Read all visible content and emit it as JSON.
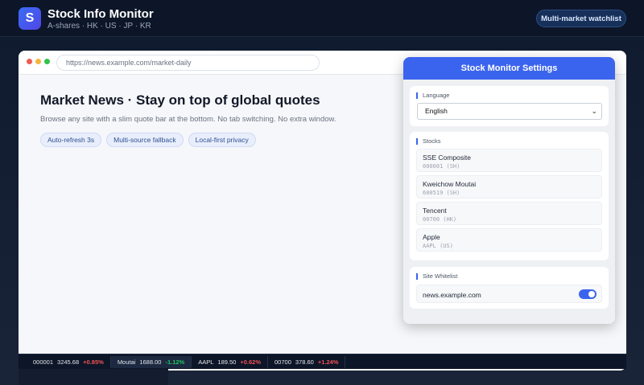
{
  "app": {
    "logo_letter": "S",
    "title": "Stock Info Monitor",
    "subtitle": "A-shares · HK · US · JP · KR",
    "watchlist_button": "Multi-market watchlist"
  },
  "browser": {
    "url": "https://news.example.com/market-daily"
  },
  "page": {
    "title": "Market News · Stay on top of global quotes",
    "description": "Browse any site with a slim quote bar at the bottom. No tab switching. No extra window.",
    "chips": [
      "Auto-refresh 3s",
      "Multi-source fallback",
      "Local-first privacy"
    ]
  },
  "settings": {
    "title": "Stock Monitor Settings",
    "language": {
      "label": "Language",
      "selected": "English"
    },
    "stocks": {
      "label": "Stocks",
      "items": [
        {
          "name": "SSE Composite",
          "code": "000001 (SH)"
        },
        {
          "name": "Kweichow Moutai",
          "code": "600519 (SH)"
        },
        {
          "name": "Tencent",
          "code": "00700 (HK)"
        },
        {
          "name": "Apple",
          "code": "AAPL (US)"
        }
      ]
    },
    "whitelist": {
      "label": "Site Whitelist",
      "site": "news.example.com",
      "enabled": true
    }
  },
  "ticker": [
    {
      "symbol": "000001",
      "price": "3245.68",
      "change": "+0.85%",
      "direction": "up"
    },
    {
      "symbol": "Moutai",
      "price": "1688.00",
      "change": "-1.12%",
      "direction": "down"
    },
    {
      "symbol": "AAPL",
      "price": "189.50",
      "change": "+0.62%",
      "direction": "up"
    },
    {
      "symbol": "00700",
      "price": "378.60",
      "change": "+1.24%",
      "direction": "up"
    }
  ],
  "colors": {
    "accent": "#3b64ee",
    "up": "#f05252",
    "down": "#22c55e"
  }
}
